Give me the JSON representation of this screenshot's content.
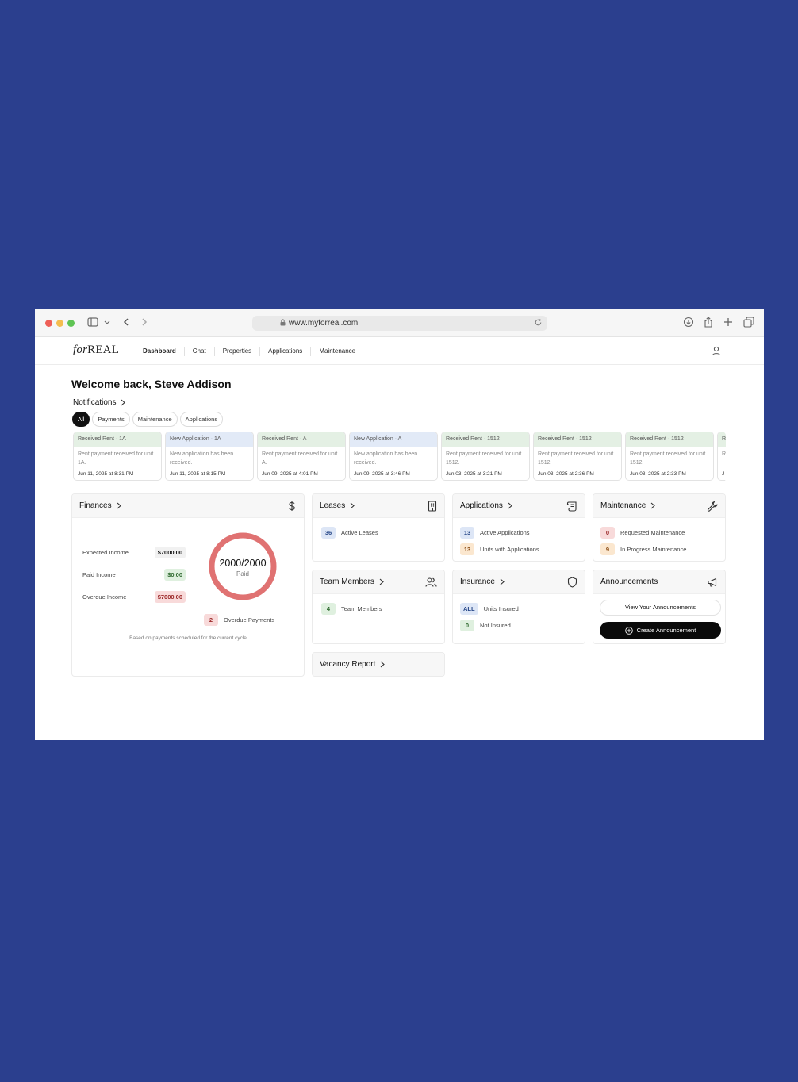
{
  "browser": {
    "url": "www.myforreal.com"
  },
  "app": {
    "logo_prefix": "for",
    "logo_suffix": "REAL",
    "nav": [
      "Dashboard",
      "Chat",
      "Properties",
      "Applications",
      "Maintenance"
    ],
    "active_nav": "Dashboard"
  },
  "welcome": "Welcome back, Steve Addison",
  "notifications": {
    "title": "Notifications",
    "filters": [
      "All",
      "Payments",
      "Maintenance",
      "Applications"
    ],
    "active_filter": "All",
    "items": [
      {
        "type": "rent",
        "title": "Received Rent · 1A",
        "body": "Rent payment received for unit 1A.",
        "date": "Jun 11, 2025 at 8:31 PM"
      },
      {
        "type": "app",
        "title": "New Application · 1A",
        "body": "New application has been received.",
        "date": "Jun 11, 2025 at 8:15 PM"
      },
      {
        "type": "rent",
        "title": "Received Rent · A",
        "body": "Rent payment received for unit A.",
        "date": "Jun 09, 2025 at 4:01 PM"
      },
      {
        "type": "app",
        "title": "New Application · A",
        "body": "New application has been received.",
        "date": "Jun 09, 2025 at 3:46 PM"
      },
      {
        "type": "rent",
        "title": "Received Rent · 1512",
        "body": "Rent payment received for unit 1512.",
        "date": "Jun 03, 2025 at 3:21 PM"
      },
      {
        "type": "rent",
        "title": "Received Rent · 1512",
        "body": "Rent payment received for unit 1512.",
        "date": "Jun 03, 2025 at 2:36 PM"
      },
      {
        "type": "rent",
        "title": "Received Rent · 1512",
        "body": "Rent payment received for unit 1512.",
        "date": "Jun 03, 2025 at 2:33 PM"
      },
      {
        "type": "rent",
        "title": "R",
        "body": "R u",
        "date": "J"
      }
    ]
  },
  "finances": {
    "title": "Finances",
    "expected_label": "Expected Income",
    "expected_value": "$7000.00",
    "paid_label": "Paid Income",
    "paid_value": "$0.00",
    "overdue_label": "Overdue Income",
    "overdue_value": "$7000.00",
    "donut_value": "2000/2000",
    "donut_label": "Paid",
    "donut_fraction": 1.0,
    "overdue_payments_count": "2",
    "overdue_payments_label": "Overdue Payments",
    "note": "Based on payments scheduled for the current cycle"
  },
  "leases": {
    "title": "Leases",
    "active_count": "36",
    "active_label": "Active Leases"
  },
  "applications": {
    "title": "Applications",
    "active_count": "13",
    "active_label": "Active Applications",
    "units_count": "13",
    "units_label": "Units with Applications"
  },
  "maintenance": {
    "title": "Maintenance",
    "requested_count": "0",
    "requested_label": "Requested Maintenance",
    "progress_count": "9",
    "progress_label": "In Progress Maintenance"
  },
  "team": {
    "title": "Team Members",
    "count": "4",
    "label": "Team Members"
  },
  "insurance": {
    "title": "Insurance",
    "insured_count": "ALL",
    "insured_label": "Units Insured",
    "not_insured_count": "0",
    "not_insured_label": "Not Insured"
  },
  "announcements": {
    "title": "Announcements",
    "view_label": "View Your Announcements",
    "create_label": "Create Announcement"
  },
  "vacancy": {
    "title": "Vacancy Report"
  },
  "colors": {
    "background": "#2b3f8e",
    "donut": "#e07272"
  }
}
